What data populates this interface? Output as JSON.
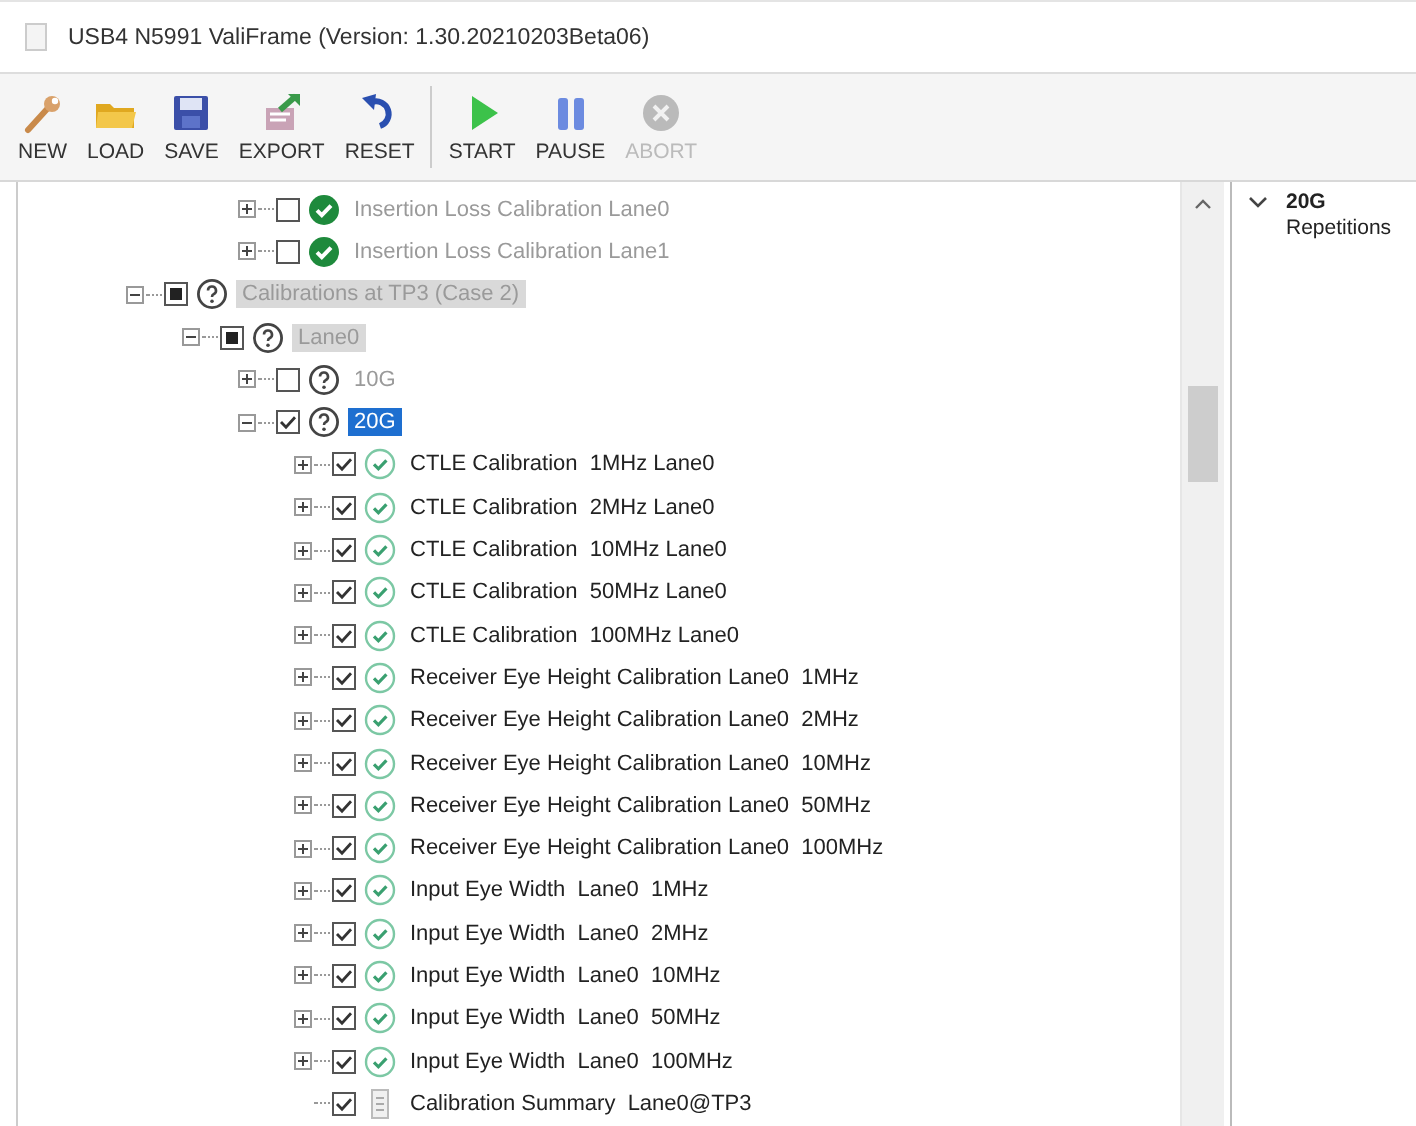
{
  "window": {
    "title": "USB4 N5991 ValiFrame (Version: 1.30.20210203Beta06)"
  },
  "toolbar": [
    {
      "label": "NEW",
      "kind": "wrench",
      "disabled": false
    },
    {
      "label": "LOAD",
      "kind": "folder",
      "disabled": false
    },
    {
      "label": "SAVE",
      "kind": "disk",
      "disabled": false
    },
    {
      "label": "EXPORT",
      "kind": "export",
      "disabled": false
    },
    {
      "label": "RESET",
      "kind": "reset",
      "disabled": false
    },
    {
      "label": "START",
      "kind": "start",
      "disabled": false,
      "separator_before": true
    },
    {
      "label": "PAUSE",
      "kind": "pause",
      "disabled": false
    },
    {
      "label": "ABORT",
      "kind": "abort",
      "disabled": true
    }
  ],
  "tree": {
    "scrolled_items": [
      {
        "label": "Insertion Loss Calibration Lane0",
        "checked": false,
        "partial": false,
        "kind": "passed",
        "expanded": false,
        "disabled": true,
        "shaded": false,
        "selected": false
      },
      {
        "label": "Insertion Loss Calibration Lane1",
        "checked": false,
        "partial": false,
        "kind": "passed",
        "expanded": false,
        "disabled": true,
        "shaded": false,
        "selected": false
      }
    ],
    "items": [
      {
        "label": "Calibrations at TP3 (Case 2)",
        "checked": false,
        "partial": true,
        "kind": "pending",
        "expanded": true,
        "disabled": true,
        "shaded": true,
        "selected": false,
        "children": [
          {
            "label": "Lane0",
            "checked": false,
            "partial": true,
            "kind": "pending",
            "expanded": true,
            "disabled": true,
            "shaded": true,
            "selected": false,
            "children": [
              {
                "label": "10G",
                "checked": false,
                "partial": false,
                "kind": "pending",
                "expanded": false,
                "disabled": true,
                "shaded": false,
                "selected": false
              },
              {
                "label": "20G",
                "checked": true,
                "partial": false,
                "kind": "pending",
                "expanded": true,
                "disabled": false,
                "shaded": false,
                "selected": true,
                "children": [
                  {
                    "label": "CTLE Calibration  1MHz Lane0",
                    "checked": true,
                    "partial": false,
                    "kind": "done",
                    "expanded": false,
                    "disabled": false,
                    "shaded": false,
                    "selected": false
                  },
                  {
                    "label": "CTLE Calibration  2MHz Lane0",
                    "checked": true,
                    "partial": false,
                    "kind": "done",
                    "expanded": false,
                    "disabled": false,
                    "shaded": false,
                    "selected": false
                  },
                  {
                    "label": "CTLE Calibration  10MHz Lane0",
                    "checked": true,
                    "partial": false,
                    "kind": "done",
                    "expanded": false,
                    "disabled": false,
                    "shaded": false,
                    "selected": false
                  },
                  {
                    "label": "CTLE Calibration  50MHz Lane0",
                    "checked": true,
                    "partial": false,
                    "kind": "done",
                    "expanded": false,
                    "disabled": false,
                    "shaded": false,
                    "selected": false
                  },
                  {
                    "label": "CTLE Calibration  100MHz Lane0",
                    "checked": true,
                    "partial": false,
                    "kind": "done",
                    "expanded": false,
                    "disabled": false,
                    "shaded": false,
                    "selected": false
                  },
                  {
                    "label": "Receiver Eye Height Calibration Lane0  1MHz",
                    "checked": true,
                    "partial": false,
                    "kind": "done",
                    "expanded": false,
                    "disabled": false,
                    "shaded": false,
                    "selected": false
                  },
                  {
                    "label": "Receiver Eye Height Calibration Lane0  2MHz",
                    "checked": true,
                    "partial": false,
                    "kind": "done",
                    "expanded": false,
                    "disabled": false,
                    "shaded": false,
                    "selected": false
                  },
                  {
                    "label": "Receiver Eye Height Calibration Lane0  10MHz",
                    "checked": true,
                    "partial": false,
                    "kind": "done",
                    "expanded": false,
                    "disabled": false,
                    "shaded": false,
                    "selected": false
                  },
                  {
                    "label": "Receiver Eye Height Calibration Lane0  50MHz",
                    "checked": true,
                    "partial": false,
                    "kind": "done",
                    "expanded": false,
                    "disabled": false,
                    "shaded": false,
                    "selected": false
                  },
                  {
                    "label": "Receiver Eye Height Calibration Lane0  100MHz",
                    "checked": true,
                    "partial": false,
                    "kind": "done",
                    "expanded": false,
                    "disabled": false,
                    "shaded": false,
                    "selected": false
                  },
                  {
                    "label": "Input Eye Width  Lane0  1MHz",
                    "checked": true,
                    "partial": false,
                    "kind": "done",
                    "expanded": false,
                    "disabled": false,
                    "shaded": false,
                    "selected": false
                  },
                  {
                    "label": "Input Eye Width  Lane0  2MHz",
                    "checked": true,
                    "partial": false,
                    "kind": "done",
                    "expanded": false,
                    "disabled": false,
                    "shaded": false,
                    "selected": false
                  },
                  {
                    "label": "Input Eye Width  Lane0  10MHz",
                    "checked": true,
                    "partial": false,
                    "kind": "done",
                    "expanded": false,
                    "disabled": false,
                    "shaded": false,
                    "selected": false
                  },
                  {
                    "label": "Input Eye Width  Lane0  50MHz",
                    "checked": true,
                    "partial": false,
                    "kind": "done",
                    "expanded": false,
                    "disabled": false,
                    "shaded": false,
                    "selected": false
                  },
                  {
                    "label": "Input Eye Width  Lane0  100MHz",
                    "checked": true,
                    "partial": false,
                    "kind": "done",
                    "expanded": false,
                    "disabled": false,
                    "shaded": false,
                    "selected": false
                  },
                  {
                    "label": "Calibration Summary  Lane0@TP3",
                    "checked": true,
                    "partial": false,
                    "kind": "summary",
                    "disabled": false,
                    "shaded": false,
                    "selected": false
                  }
                ]
              }
            ]
          }
        ]
      }
    ]
  },
  "properties": {
    "heading": "20G",
    "expanded": true,
    "field": "Repetitions"
  }
}
